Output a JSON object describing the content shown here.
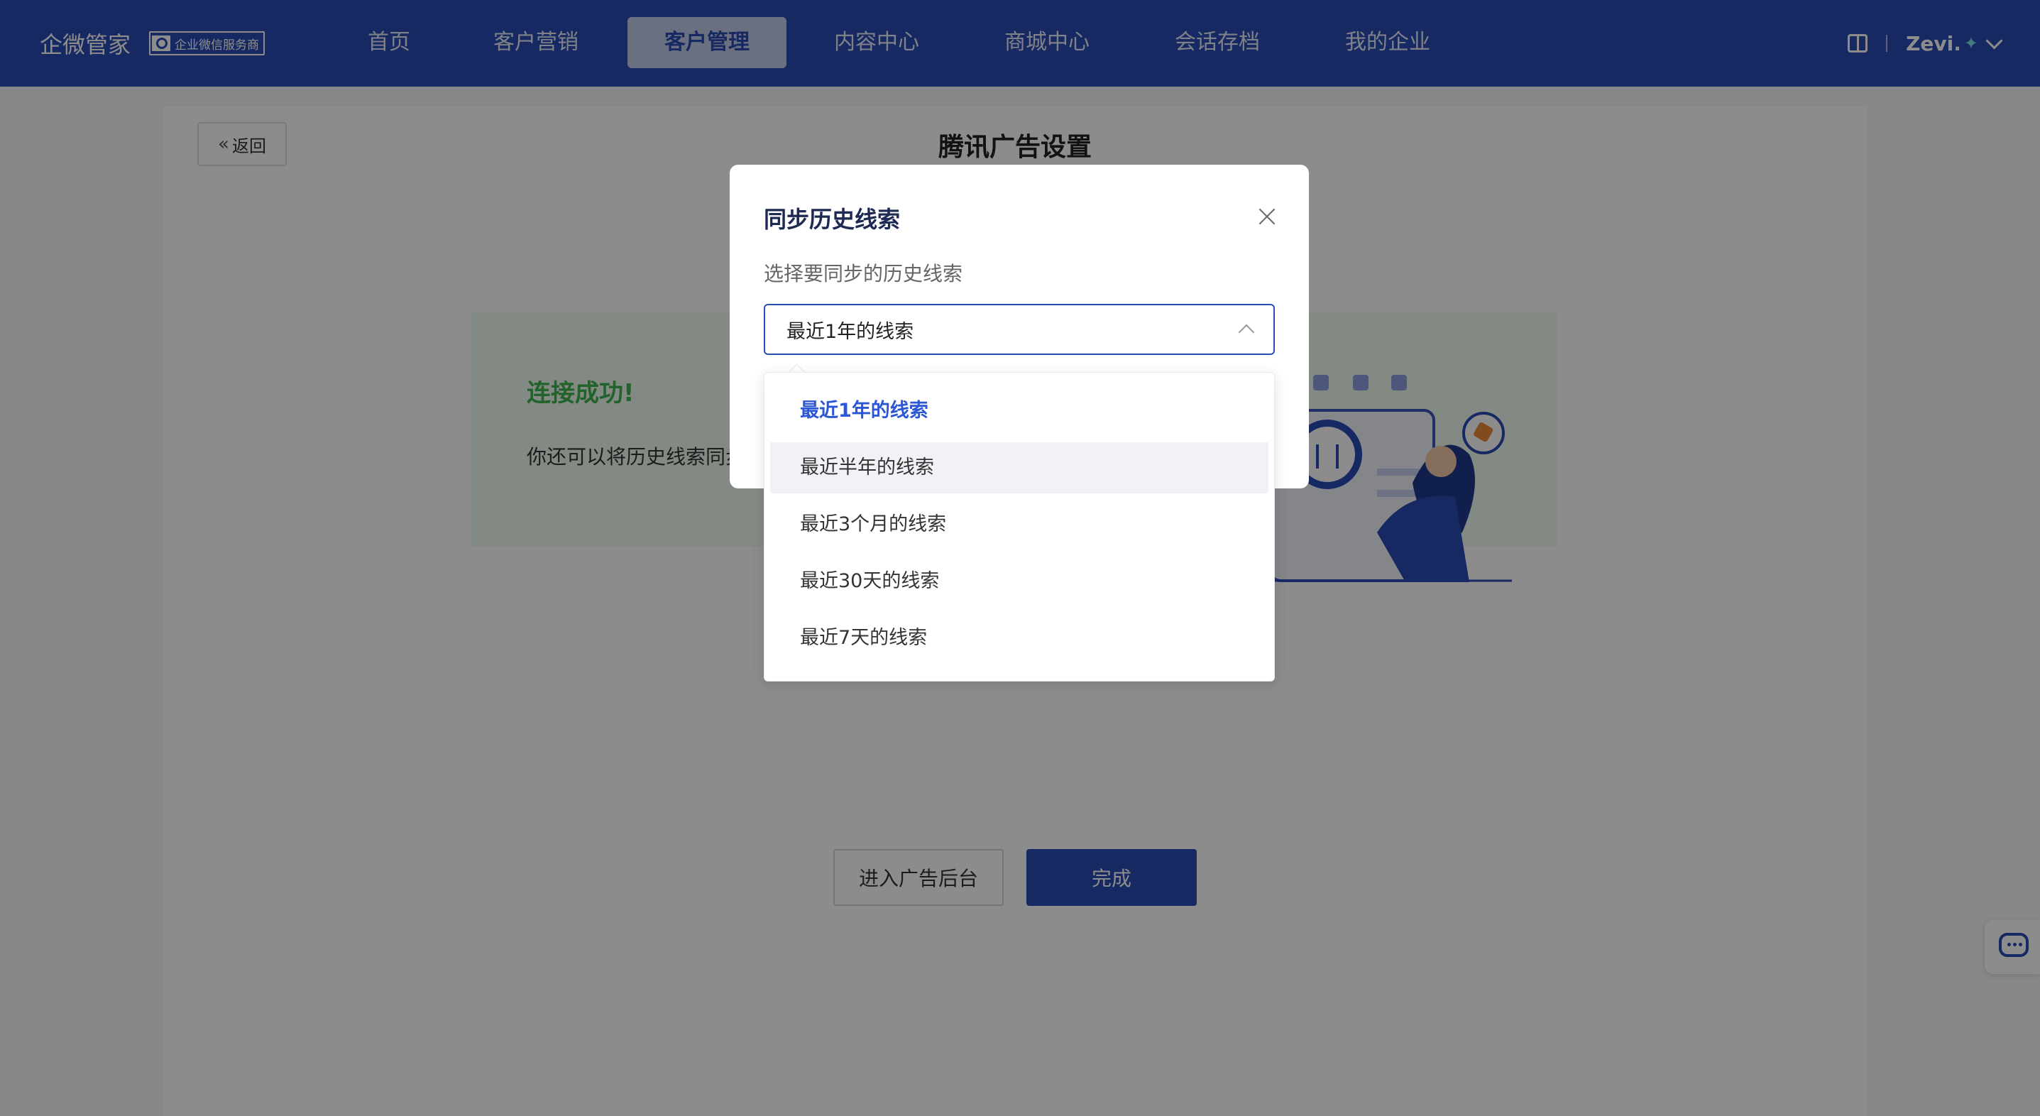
{
  "header": {
    "brand": "企微管家",
    "brand_badge": "企业微信服务商",
    "nav": [
      {
        "label": "首页",
        "active": false
      },
      {
        "label": "客户营销",
        "active": false
      },
      {
        "label": "客户管理",
        "active": true
      },
      {
        "label": "内容中心",
        "active": false
      },
      {
        "label": "商城中心",
        "active": false
      },
      {
        "label": "会话存档",
        "active": false
      },
      {
        "label": "我的企业",
        "active": false
      }
    ],
    "user": "Zevi."
  },
  "page": {
    "back_label": "返回",
    "title": "腾讯广告设置",
    "success_title": "连接成功!",
    "success_desc": "你还可以将历史线索同步",
    "enter_button": "进入广告后台",
    "done_button": "完成"
  },
  "modal": {
    "title": "同步历史线索",
    "label": "选择要同步的历史线索",
    "selected_value": "最近1年的线索",
    "options": [
      {
        "label": "最近1年的线索",
        "selected": true
      },
      {
        "label": "最近半年的线索",
        "selected": false
      },
      {
        "label": "最近3个月的线索",
        "selected": false
      },
      {
        "label": "最近30天的线索",
        "selected": false
      },
      {
        "label": "最近7天的线索",
        "selected": false
      }
    ]
  },
  "colors": {
    "primary": "#2b4bb4",
    "success": "#3fb34f",
    "option_selected": "#2b56d6"
  }
}
